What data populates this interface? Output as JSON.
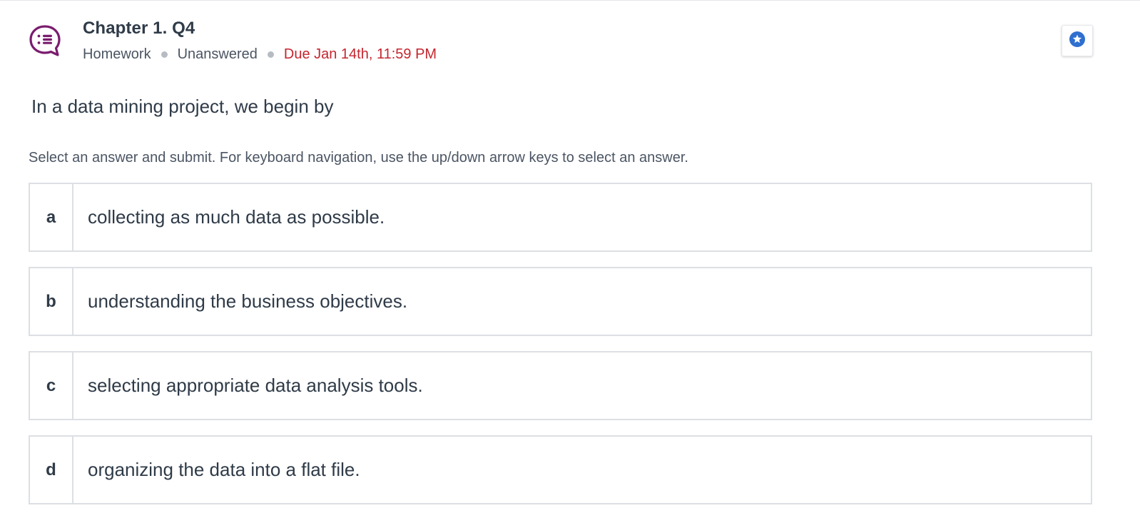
{
  "header": {
    "title": "Chapter 1. Q4",
    "type": "Homework",
    "status": "Unanswered",
    "due": "Due Jan 14th, 11:59 PM",
    "icon": "question-bubble-icon",
    "bookmark_icon": "star-icon"
  },
  "question": {
    "prompt": "In a data mining project, we begin by",
    "instructions": "Select an answer and submit. For keyboard navigation, use the up/down arrow keys to select an answer."
  },
  "options": [
    {
      "letter": "a",
      "text": "collecting as much data as possible."
    },
    {
      "letter": "b",
      "text": "understanding the business objectives."
    },
    {
      "letter": "c",
      "text": "selecting appropriate data analysis tools."
    },
    {
      "letter": "d",
      "text": "organizing the data into a flat file."
    }
  ],
  "colors": {
    "accent_purple": "#7a1c6e",
    "due_red": "#c4262e",
    "bookmark_blue": "#2f6fcf",
    "text": "#2f3b48",
    "border": "#dcdfe3"
  }
}
